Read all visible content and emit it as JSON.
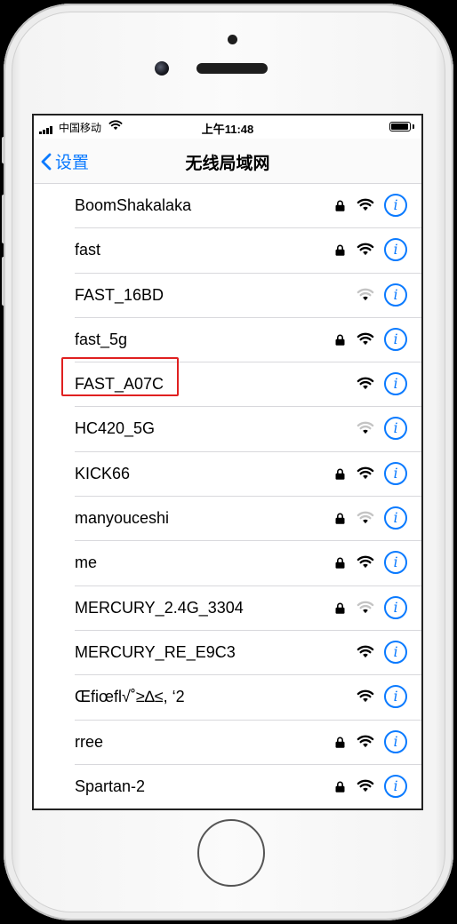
{
  "status_bar": {
    "carrier": "中国移动",
    "time": "上午11:48",
    "signal_bars": 4,
    "battery_level": 0.95
  },
  "nav": {
    "back_label": "设置",
    "title": "无线局域网"
  },
  "networks": [
    {
      "ssid": "BoomShakalaka",
      "locked": true,
      "signal": "strong"
    },
    {
      "ssid": "fast",
      "locked": true,
      "signal": "strong"
    },
    {
      "ssid": "FAST_16BD",
      "locked": false,
      "signal": "weak"
    },
    {
      "ssid": "fast_5g",
      "locked": true,
      "signal": "strong"
    },
    {
      "ssid": "FAST_A07C",
      "locked": false,
      "signal": "strong",
      "highlighted": true
    },
    {
      "ssid": "HC420_5G",
      "locked": false,
      "signal": "weak"
    },
    {
      "ssid": "KICK66",
      "locked": true,
      "signal": "strong"
    },
    {
      "ssid": "manyouceshi",
      "locked": true,
      "signal": "weak"
    },
    {
      "ssid": "me",
      "locked": true,
      "signal": "strong"
    },
    {
      "ssid": "MERCURY_2.4G_3304",
      "locked": true,
      "signal": "weak"
    },
    {
      "ssid": "MERCURY_RE_E9C3",
      "locked": false,
      "signal": "strong"
    },
    {
      "ssid": "Œfiœfl√˚≥∆≤, ‘2",
      "locked": false,
      "signal": "strong"
    },
    {
      "ssid": "rree",
      "locked": true,
      "signal": "strong"
    },
    {
      "ssid": "Spartan-2",
      "locked": true,
      "signal": "strong"
    }
  ],
  "icons": {
    "back": "chevron-left-icon",
    "lock": "lock-icon",
    "wifi": "wifi-icon",
    "info": "info-icon"
  },
  "colors": {
    "accent": "#0a7aff",
    "highlight": "#e02020"
  }
}
